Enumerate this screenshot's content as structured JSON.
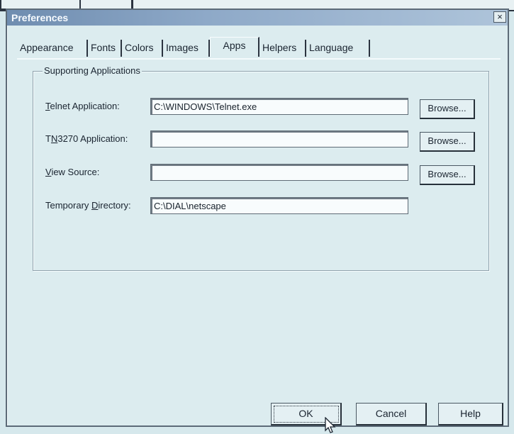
{
  "window": {
    "title": "Preferences",
    "close_glyph": "×"
  },
  "tabs": [
    {
      "label": "Appearance",
      "active": false
    },
    {
      "label": "Fonts",
      "active": false
    },
    {
      "label": "Colors",
      "active": false
    },
    {
      "label": "Images",
      "active": false
    },
    {
      "label": "Apps",
      "active": true
    },
    {
      "label": "Helpers",
      "active": false
    },
    {
      "label": "Language",
      "active": false
    }
  ],
  "group": {
    "title": "Supporting Applications",
    "rows": [
      {
        "label_pre": "",
        "label_key": "T",
        "label_post": "elnet Application:",
        "value": "C:\\WINDOWS\\Telnet.exe",
        "browse": "Browse..."
      },
      {
        "label_pre": "T",
        "label_key": "N",
        "label_post": "3270 Application:",
        "value": "",
        "browse": "Browse..."
      },
      {
        "label_pre": "",
        "label_key": "V",
        "label_post": "iew Source:",
        "value": "",
        "browse": "Browse..."
      },
      {
        "label_pre": "Temporary ",
        "label_key": "D",
        "label_post": "irectory:",
        "value": "C:\\DIAL\\netscape"
      }
    ]
  },
  "buttons": {
    "ok": "OK",
    "cancel": "Cancel",
    "help": "Help"
  },
  "icons": {
    "cursor": "arrow-cursor-icon"
  }
}
